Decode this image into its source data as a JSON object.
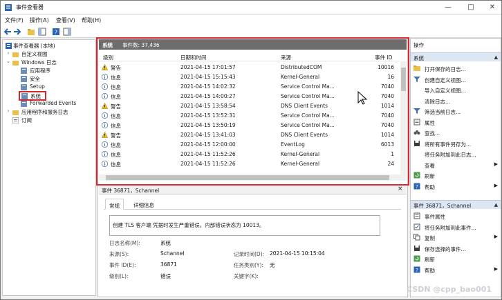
{
  "window": {
    "title": "事件查看器",
    "controls": [
      "—",
      "□",
      "✕"
    ]
  },
  "menu": {
    "items": [
      "文件(F)",
      "操作(A)",
      "查看(V)",
      "帮助(H)"
    ]
  },
  "tree": {
    "root": "事件查看器 (本地)",
    "custom_views": "自定义视图",
    "windows_logs": "Windows 日志",
    "application": "应用程序",
    "security": "安全",
    "setup": "Setup",
    "system": "系统",
    "forwarded": "Forwarded Events",
    "apps_services": "应用程序和服务日志",
    "subscriptions": "订阅"
  },
  "log_header": {
    "name": "系统",
    "count_label": "事件数: 37,436"
  },
  "columns": {
    "level": "级别",
    "datetime": "日期和时间",
    "source": "来源",
    "event_id": "事件 ID"
  },
  "events": [
    {
      "level": "警告",
      "icon": "warning-icon",
      "datetime": "2021-04-15 17:01:57",
      "source": "DistributedCOM",
      "event_id": "10016"
    },
    {
      "level": "信息",
      "icon": "info-icon",
      "datetime": "2021-04-15 15:15:43",
      "source": "Kernel-General",
      "event_id": "16"
    },
    {
      "level": "信息",
      "icon": "info-icon",
      "datetime": "2021-04-15 14:02:32",
      "source": "Service Control Ma...",
      "event_id": "7040"
    },
    {
      "level": "信息",
      "icon": "info-icon",
      "datetime": "2021-04-15 14:00:27",
      "source": "Service Control Ma...",
      "event_id": "7040"
    },
    {
      "level": "警告",
      "icon": "warning-icon",
      "datetime": "2021-04-15 13:58:54",
      "source": "DNS Client Events",
      "event_id": "1014"
    },
    {
      "level": "信息",
      "icon": "info-icon",
      "datetime": "2021-04-15 13:52:31",
      "source": "Service Control Ma...",
      "event_id": "7040"
    },
    {
      "level": "信息",
      "icon": "info-icon",
      "datetime": "2021-04-15 13:50:19",
      "source": "Service Control Ma...",
      "event_id": "7040"
    },
    {
      "level": "警告",
      "icon": "warning-icon",
      "datetime": "2021-04-15 13:41:03",
      "source": "DNS Client Events",
      "event_id": "1014"
    },
    {
      "level": "信息",
      "icon": "info-icon",
      "datetime": "2021-04-15 12:00:00",
      "source": "EventLog",
      "event_id": "6013"
    },
    {
      "level": "信息",
      "icon": "info-icon",
      "datetime": "2021-04-15 11:52:26",
      "source": "Kernel-General",
      "event_id": "1"
    },
    {
      "level": "信息",
      "icon": "info-icon",
      "datetime": "2021-04-15 11:52:26",
      "source": "Kernel-General",
      "event_id": "24"
    }
  ],
  "detail": {
    "header": "事件 36871，Schannel",
    "close": "×",
    "tab_general": "常规",
    "tab_details": "详细信息",
    "message": "创建 TLS 客户端 凭据时发生严重错误。内部错误状态为 10013。",
    "log_name_label": "日志名称(M):",
    "log_name": "系统",
    "source_label": "来源(S):",
    "source": "Schannel",
    "logged_label": "记录时间(D):",
    "logged": "2021-04-15 10:15:04",
    "event_id_label": "事件 ID(E):",
    "event_id": "36871",
    "task_label": "任务类别(Y):",
    "task": "无",
    "level_label": "级别(L):",
    "level": "错误",
    "keywords_label": "关键字(K):"
  },
  "actions": {
    "header": "操作",
    "section1": "系统",
    "items1": [
      {
        "label": "打开保存的日志...",
        "icon": "folder-open-icon"
      },
      {
        "label": "创建自定义视图...",
        "icon": "filter-icon"
      },
      {
        "label": "导入自定义视图...",
        "icon": "blank"
      },
      {
        "label": "清除日志...",
        "icon": "blank"
      },
      {
        "label": "筛选当前日志...",
        "icon": "filter-icon"
      },
      {
        "label": "属性",
        "icon": "properties-icon"
      },
      {
        "label": "查找...",
        "icon": "binoculars-icon"
      },
      {
        "label": "将所有事件另存为...",
        "icon": "save-icon"
      },
      {
        "label": "将任务附加到此日志...",
        "icon": "blank"
      },
      {
        "label": "查看",
        "icon": "blank",
        "submenu": true
      },
      {
        "label": "刷新",
        "icon": "refresh-icon"
      },
      {
        "label": "帮助",
        "icon": "help-icon",
        "submenu": true
      }
    ],
    "section2": "事件 36871，Schannel",
    "items2": [
      {
        "label": "事件属性",
        "icon": "properties-icon"
      },
      {
        "label": "将任务附加到此事件...",
        "icon": "task-icon"
      },
      {
        "label": "复制",
        "icon": "copy-icon",
        "submenu": true
      },
      {
        "label": "保存选择的事件...",
        "icon": "save-icon"
      },
      {
        "label": "刷新",
        "icon": "refresh-icon"
      },
      {
        "label": "帮助",
        "icon": "help-icon",
        "submenu": true
      }
    ]
  },
  "watermark": "CSDN @cpp_bao001",
  "colors": {
    "highlight_box": "#d6262e",
    "section_bg": "#dde7f3",
    "log_header_bg": "#6d6d6d"
  }
}
